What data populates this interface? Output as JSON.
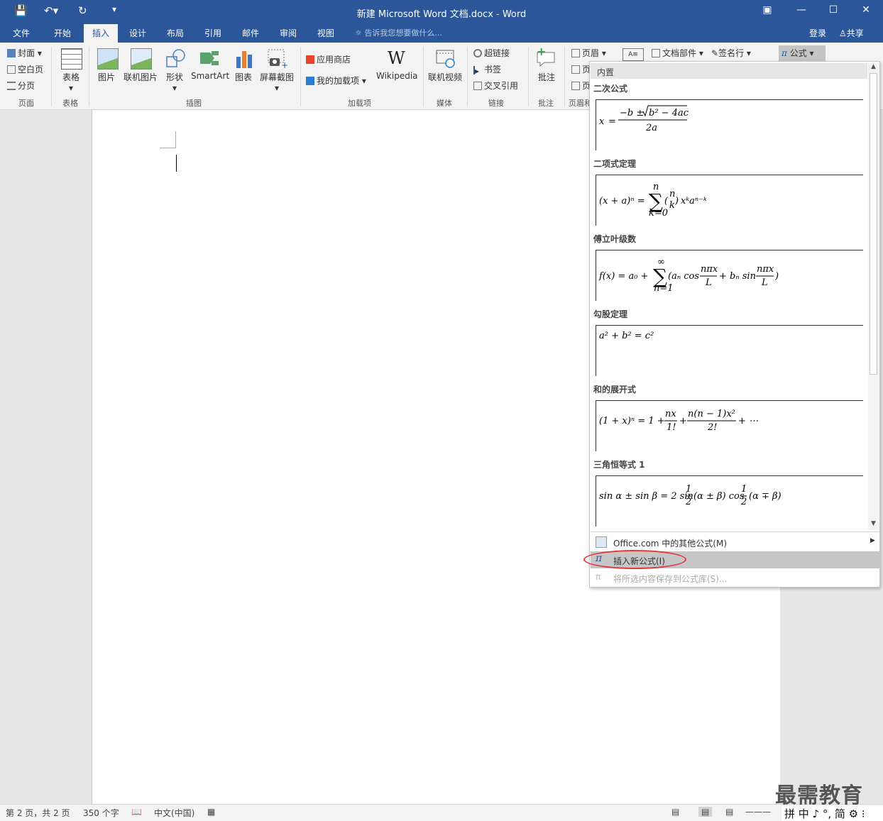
{
  "window": {
    "title": "新建 Microsoft Word 文档.docx - Word",
    "controls": [
      "restore-ribbon",
      "minimize",
      "maximize",
      "close"
    ]
  },
  "tabs": [
    {
      "label": "文件"
    },
    {
      "label": "开始"
    },
    {
      "label": "插入",
      "active": true
    },
    {
      "label": "设计"
    },
    {
      "label": "布局"
    },
    {
      "label": "引用"
    },
    {
      "label": "邮件"
    },
    {
      "label": "审阅"
    },
    {
      "label": "视图"
    }
  ],
  "tellme": "告诉我您想要做什么...",
  "account": {
    "login": "登录",
    "share": "共享"
  },
  "ribbon": {
    "pages": {
      "cover": "封面",
      "blank": "空白页",
      "break": "分页",
      "label": "页面"
    },
    "table": {
      "button": "表格",
      "label": "表格"
    },
    "illustrations": {
      "picture": "图片",
      "online_picture": "联机图片",
      "shapes": "形状",
      "smartart": "SmartArt",
      "chart": "图表",
      "screenshot": "屏幕截图",
      "label": "插图"
    },
    "addins": {
      "store": "应用商店",
      "my_addins": "我的加载项",
      "wikipedia": "Wikipedia",
      "label": "加载项"
    },
    "media": {
      "online_video": "联机视频",
      "label": "媒体"
    },
    "links": {
      "hyperlink": "超链接",
      "bookmark": "书签",
      "crossref": "交叉引用",
      "label": "链接"
    },
    "comments": {
      "comment": "批注",
      "label": "批注"
    },
    "header_footer": {
      "header": "页眉",
      "footer_cut": "页",
      "pagenum_cut": "页",
      "label": "页眉和"
    },
    "text": {
      "parts": "文档部件",
      "signature": "签名行"
    },
    "symbols": {
      "equation": "公式"
    }
  },
  "equation_menu": {
    "header": "内置",
    "items": [
      {
        "label": "二次公式"
      },
      {
        "label": "二项式定理"
      },
      {
        "label": "傅立叶级数"
      },
      {
        "label": "勾股定理"
      },
      {
        "label": "和的展开式"
      },
      {
        "label": "三角恒等式 1"
      }
    ],
    "more": "Office.com 中的其他公式(M)",
    "insert_new": "插入新公式(I)",
    "save_selection": "将所选内容保存到公式库(S)..."
  },
  "statusbar": {
    "page": "第 2 页，共 2 页",
    "words": "350 个字",
    "language": "中文(中国)"
  },
  "watermark": "最需教育",
  "ime": "拼 中 ♪ °, 简 ⚙ ⁝",
  "colors": {
    "brand": "#2b579a",
    "highlight": "#c6c6c6",
    "annotation": "#e2373b"
  }
}
